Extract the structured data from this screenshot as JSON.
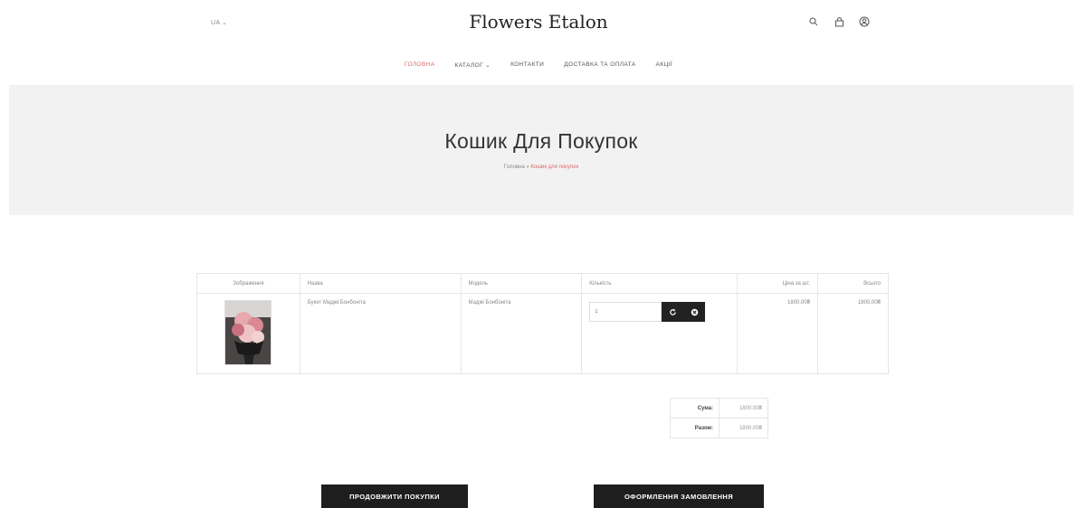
{
  "header": {
    "language": "UA ⌄",
    "brand": "Flowers Etalon",
    "icons": [
      "search-icon",
      "cart-icon",
      "account-icon"
    ]
  },
  "nav": {
    "items": [
      {
        "label": "ГОЛОВНА",
        "active": true
      },
      {
        "label": "КАТАЛОГ ⌄",
        "active": false
      },
      {
        "label": "КОНТАКТИ",
        "active": false
      },
      {
        "label": "ДОСТАВКА ТА ОПЛАТА",
        "active": false
      },
      {
        "label": "АКЦІЇ",
        "active": false
      }
    ]
  },
  "hero": {
    "title": "Кошик Для Покупок",
    "breadcrumb_home": "Головна",
    "breadcrumb_sep": "»",
    "breadcrumb_current": "Кошик для покупок"
  },
  "cart": {
    "headers": {
      "image": "Зображення",
      "name": "Назва",
      "model": "Модель",
      "quantity": "Кількість",
      "unit_price": "Ціна за шт.",
      "total": "Всього"
    },
    "items": [
      {
        "name": "Букет Маджі Бонбоніта",
        "model": "Маджі Бонбоніта",
        "quantity": "1",
        "unit_price": "1800.00₴",
        "total": "1800.00₴"
      }
    ]
  },
  "totals": {
    "rows": [
      {
        "label": "Сума:",
        "value": "1800.00₴"
      },
      {
        "label": "Разом:",
        "value": "1800.00₴"
      }
    ]
  },
  "actions": {
    "continue_label": "ПРОДОВЖИТИ ПОКУПКИ",
    "checkout_label": "ОФОРМЛЕННЯ ЗАМОВЛЕННЯ"
  },
  "colors": {
    "accent": "#d96a6a",
    "hero_bg": "#f2f2f2",
    "button_bg": "#1e1e1e"
  }
}
